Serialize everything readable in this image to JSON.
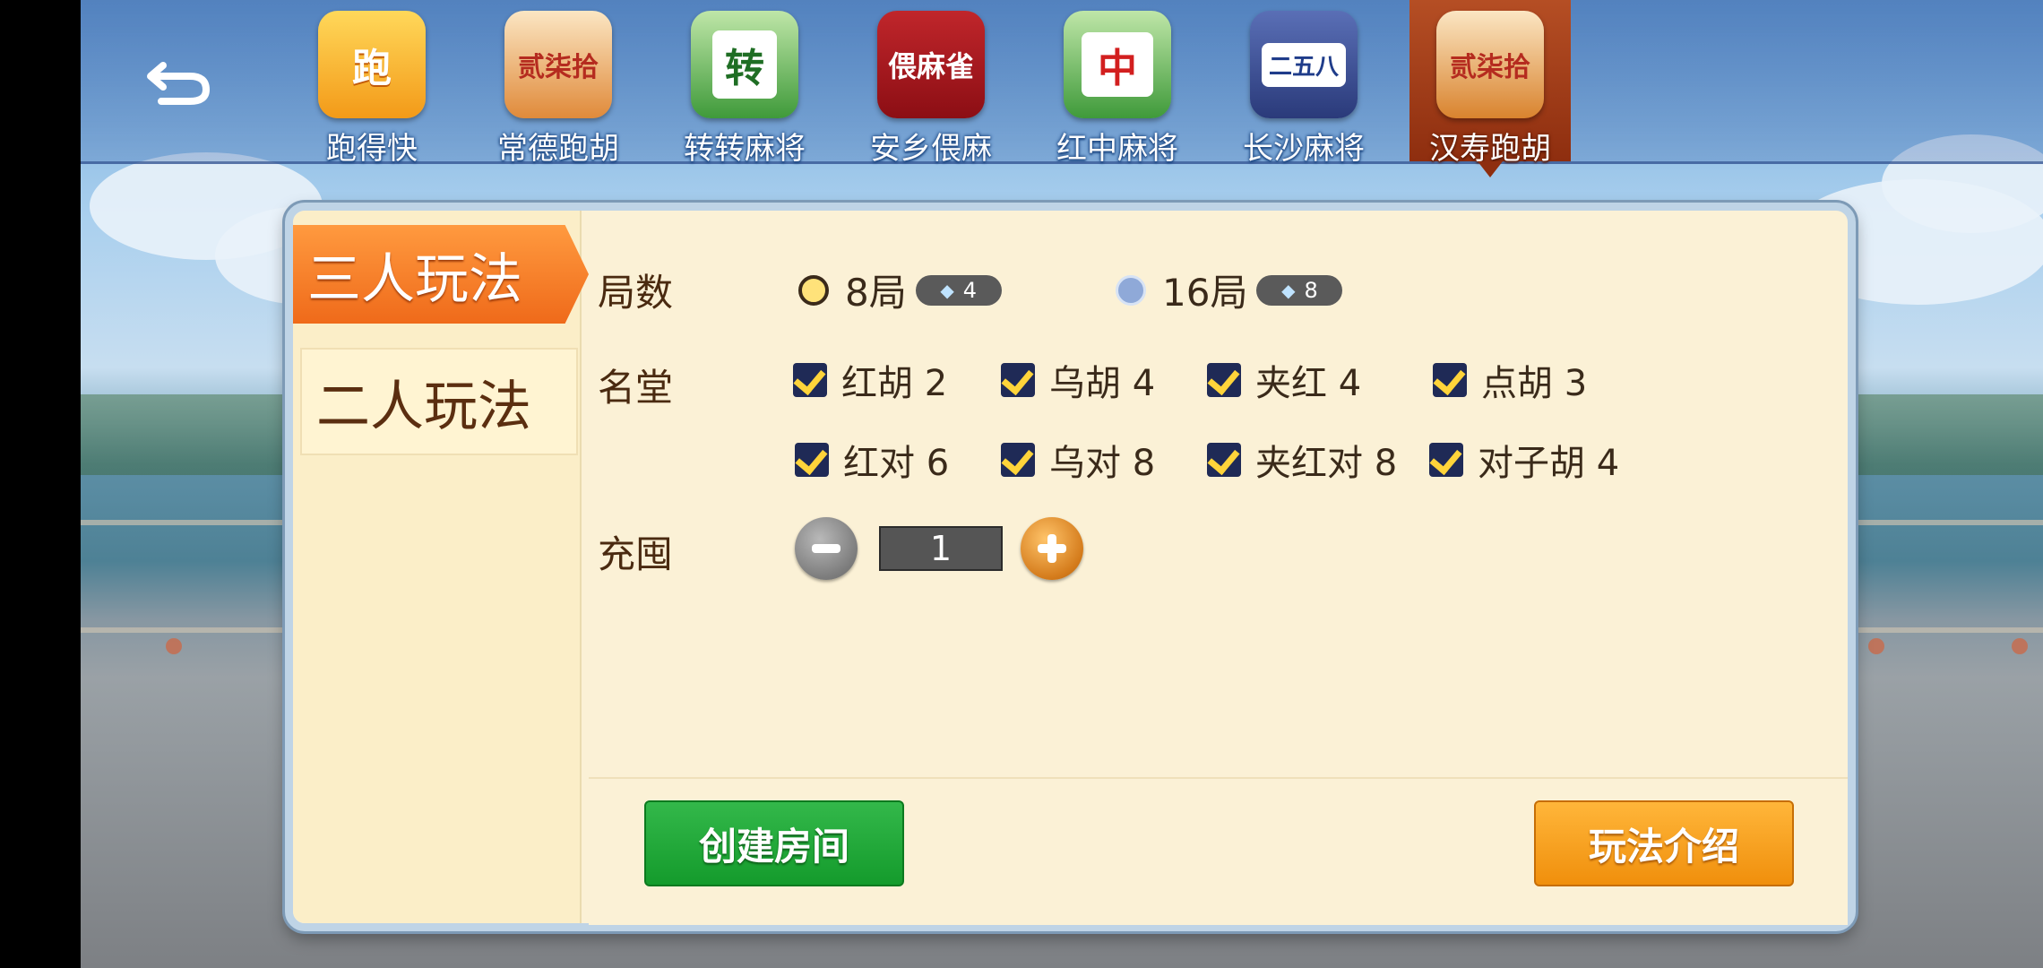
{
  "colors": {
    "active_tab": "#ef6a1a",
    "create_button": "#149b2c",
    "rules_button": "#f08f0c",
    "panel_bg": "#fbf1d6",
    "checkbox": "#1f2a56",
    "checkmark": "#ffd43a"
  },
  "topbar": {
    "back_icon": "back-arrow-icon",
    "games": [
      {
        "label": "跑得快",
        "icon": "pao-de-kuai-card-icon",
        "glyph": "跑"
      },
      {
        "label": "常德跑胡",
        "icon": "changde-paohu-icon",
        "glyph": "贰柒拾"
      },
      {
        "label": "转转麻将",
        "icon": "zhuanzhuan-mahjong-icon",
        "glyph": "转"
      },
      {
        "label": "安乡偎麻",
        "icon": "anxiang-weima-icon",
        "glyph": "偎麻雀"
      },
      {
        "label": "红中麻将",
        "icon": "hongzhong-mahjong-icon",
        "glyph": "中"
      },
      {
        "label": "长沙麻将",
        "icon": "changsha-mahjong-icon",
        "glyph": "二五八"
      },
      {
        "label": "汉寿跑胡",
        "icon": "hanshou-paohu-icon",
        "glyph": "贰柒拾",
        "active": true
      }
    ]
  },
  "modes": [
    {
      "label": "三人玩法",
      "active": true
    },
    {
      "label": "二人玩法",
      "active": false
    }
  ],
  "rounds": {
    "label": "局数",
    "options": [
      {
        "label": "8局",
        "cost": "4",
        "selected": true
      },
      {
        "label": "16局",
        "cost": "8",
        "selected": false
      }
    ]
  },
  "mingtang": {
    "label": "名堂",
    "options": [
      {
        "label": "红胡 2",
        "checked": true
      },
      {
        "label": "乌胡 4",
        "checked": true
      },
      {
        "label": "夹红 4",
        "checked": true
      },
      {
        "label": "点胡 3",
        "checked": true
      },
      {
        "label": "红对 6",
        "checked": true
      },
      {
        "label": "乌对 8",
        "checked": true
      },
      {
        "label": "夹红对 8",
        "checked": true
      },
      {
        "label": "对子胡 4",
        "checked": true
      }
    ]
  },
  "chongtun": {
    "label": "充囤",
    "value": "1",
    "minus_icon": "minus-icon",
    "plus_icon": "plus-icon"
  },
  "buttons": {
    "create_room": "创建房间",
    "rules_intro": "玩法介绍"
  }
}
